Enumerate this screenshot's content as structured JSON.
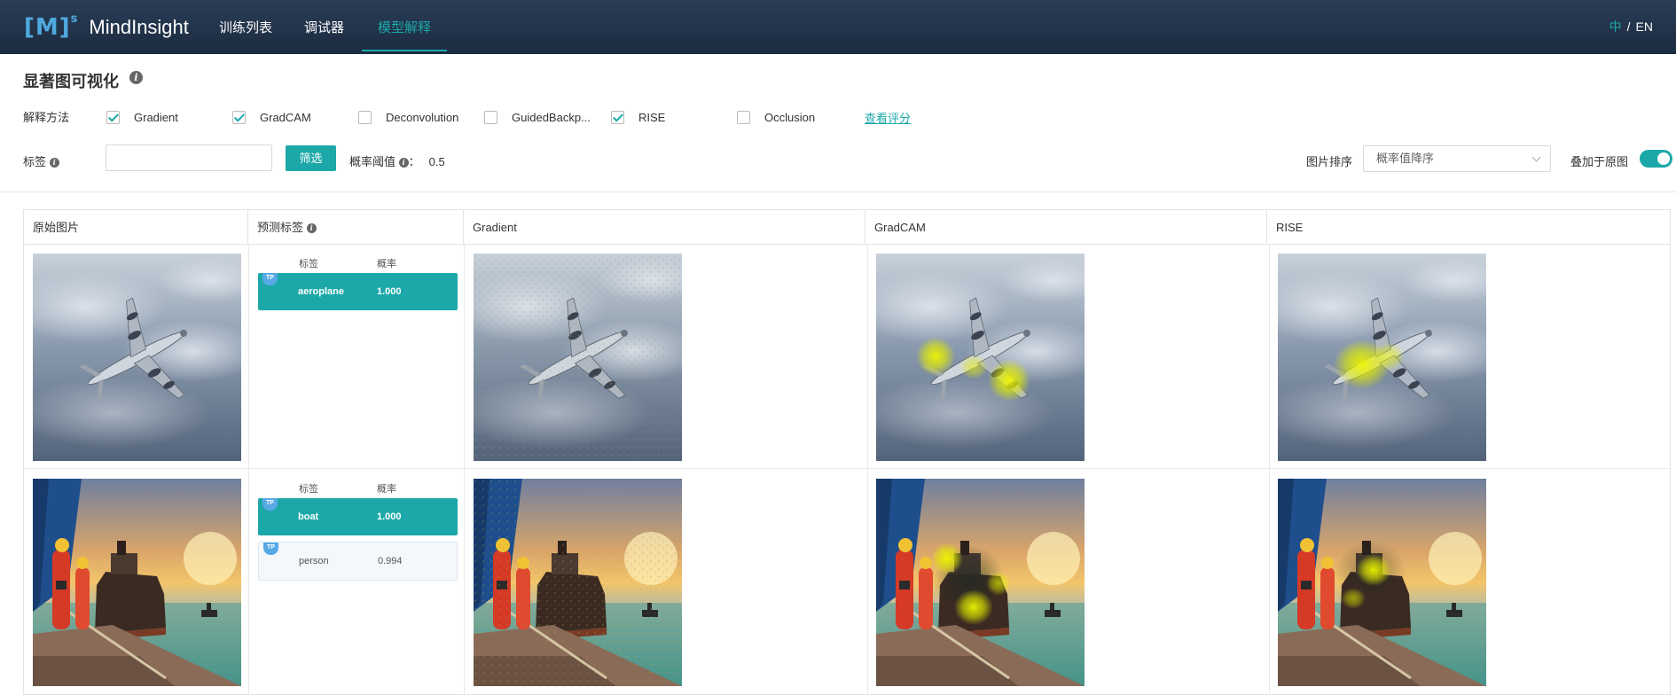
{
  "nav": {
    "logo_mark": "[M]",
    "logo_sup": "s",
    "brand": "MindInsight",
    "items": [
      {
        "label": "训练列表"
      },
      {
        "label": "调试器"
      },
      {
        "label": "模型解释"
      }
    ],
    "lang": {
      "zh": "中",
      "sep": "/",
      "en": "EN"
    }
  },
  "header": {
    "title": "显著图可视化",
    "info_glyph": "i"
  },
  "methods": {
    "label": "解释方法",
    "items": [
      {
        "label": "Gradient",
        "checked": true
      },
      {
        "label": "GradCAM",
        "checked": true
      },
      {
        "label": "Deconvolution",
        "checked": false
      },
      {
        "label": "GuidedBackp...",
        "checked": false
      },
      {
        "label": "RISE",
        "checked": true
      },
      {
        "label": "Occlusion",
        "checked": false
      }
    ],
    "view_score_link": "查看评分"
  },
  "filters": {
    "tag_label": "标签",
    "tag_input_value": "",
    "filter_button": "筛选",
    "threshold_label": "概率阈值",
    "threshold_sep": "：",
    "threshold_value": "0.5",
    "sort_label": "图片排序",
    "sort_value": "概率值降序",
    "overlay_label": "叠加于原图",
    "overlay_on": true
  },
  "table": {
    "columns": [
      "原始图片",
      "预测标签",
      "Gradient",
      "GradCAM",
      "RISE"
    ],
    "pred_head": {
      "label": "标签",
      "prob": "概率"
    },
    "rows": [
      {
        "image": "aeroplane-photo",
        "predictions": [
          {
            "badge": "TP",
            "label": "aeroplane",
            "prob": "1.000",
            "selected": true
          }
        ]
      },
      {
        "image": "boat-dock-photo",
        "predictions": [
          {
            "badge": "TP",
            "label": "boat",
            "prob": "1.000",
            "selected": true
          },
          {
            "badge": "TP",
            "label": "person",
            "prob": "0.994",
            "selected": false
          }
        ]
      }
    ]
  },
  "colors": {
    "accent": "#1ca8a8",
    "nav_bg": "#1f3048",
    "tp_badge": "#57a9e6",
    "heat": "#e8f000"
  }
}
